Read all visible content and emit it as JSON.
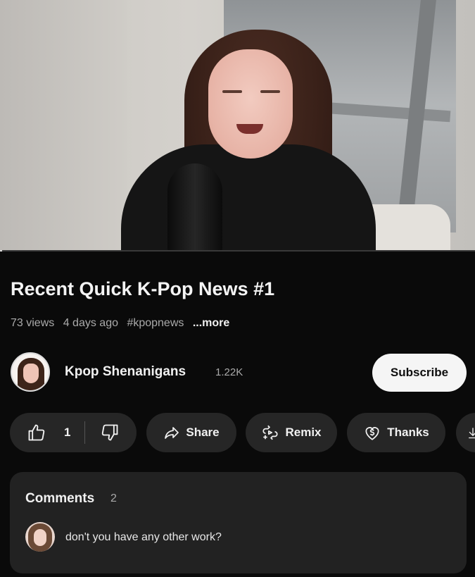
{
  "video": {
    "progress_percent": 0.4
  },
  "info": {
    "title": "Recent Quick K-Pop News #1",
    "views": "73 views",
    "age": "4 days ago",
    "hashtag": "#kpopnews",
    "more": "...more"
  },
  "channel": {
    "name": "Kpop Shenanigans",
    "subscribers": "1.22K",
    "subscribe_label": "Subscribe"
  },
  "actions": {
    "like_count": "1",
    "share_label": "Share",
    "remix_label": "Remix",
    "thanks_label": "Thanks"
  },
  "comments": {
    "title": "Comments",
    "count": "2",
    "top_comment": "don't you have any other work?"
  },
  "colors": {
    "background": "#0a0a0a",
    "pill": "#262626",
    "subscribe_bg": "#f5f5f5",
    "panel": "#222222"
  }
}
